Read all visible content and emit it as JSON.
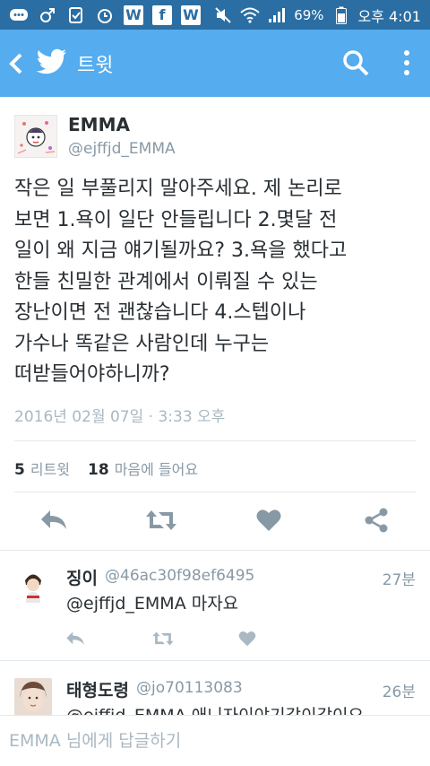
{
  "status_bar": {
    "battery": "69%",
    "time": "오후 4:01"
  },
  "app_bar": {
    "title": "트윗"
  },
  "tweet": {
    "author_name": "EMMA",
    "author_handle": "@ejffjd_EMMA",
    "text": "작은 일 부풀리지 말아주세요. 제 논리로\n보면 1.욕이 일단 안들립니다 2.몇달 전\n일이 왜 지금 얘기될까요? 3.욕을 했다고\n한들 친밀한 관계에서 이뤄질 수 있는\n장난이면 전 괜찮습니다 4.스텝이나\n가수나 똑같은 사람인데 누구는\n떠받들어야하니까?",
    "timestamp": "2016년 02월 07일 · 3:33 오후",
    "retweet_count": "5",
    "retweet_label": "리트윗",
    "like_count": "18",
    "like_label": "마음에 들어요"
  },
  "replies": [
    {
      "name": "징이",
      "handle": "@46ac30f98ef6495",
      "time": "27분",
      "text": "@ejffjd_EMMA 마자요"
    },
    {
      "name": "태형도령",
      "handle": "@jo70113083",
      "time": "26분",
      "text": "@ejffjd_EMMA 애니자이야기같이같이요"
    }
  ],
  "compose": {
    "placeholder": "EMMA 님에게 답글하기"
  },
  "colors": {
    "status_bar": "#2a6ea3",
    "app_bar": "#55acee",
    "icon_gray": "#8899a6",
    "text": "#292f33"
  }
}
